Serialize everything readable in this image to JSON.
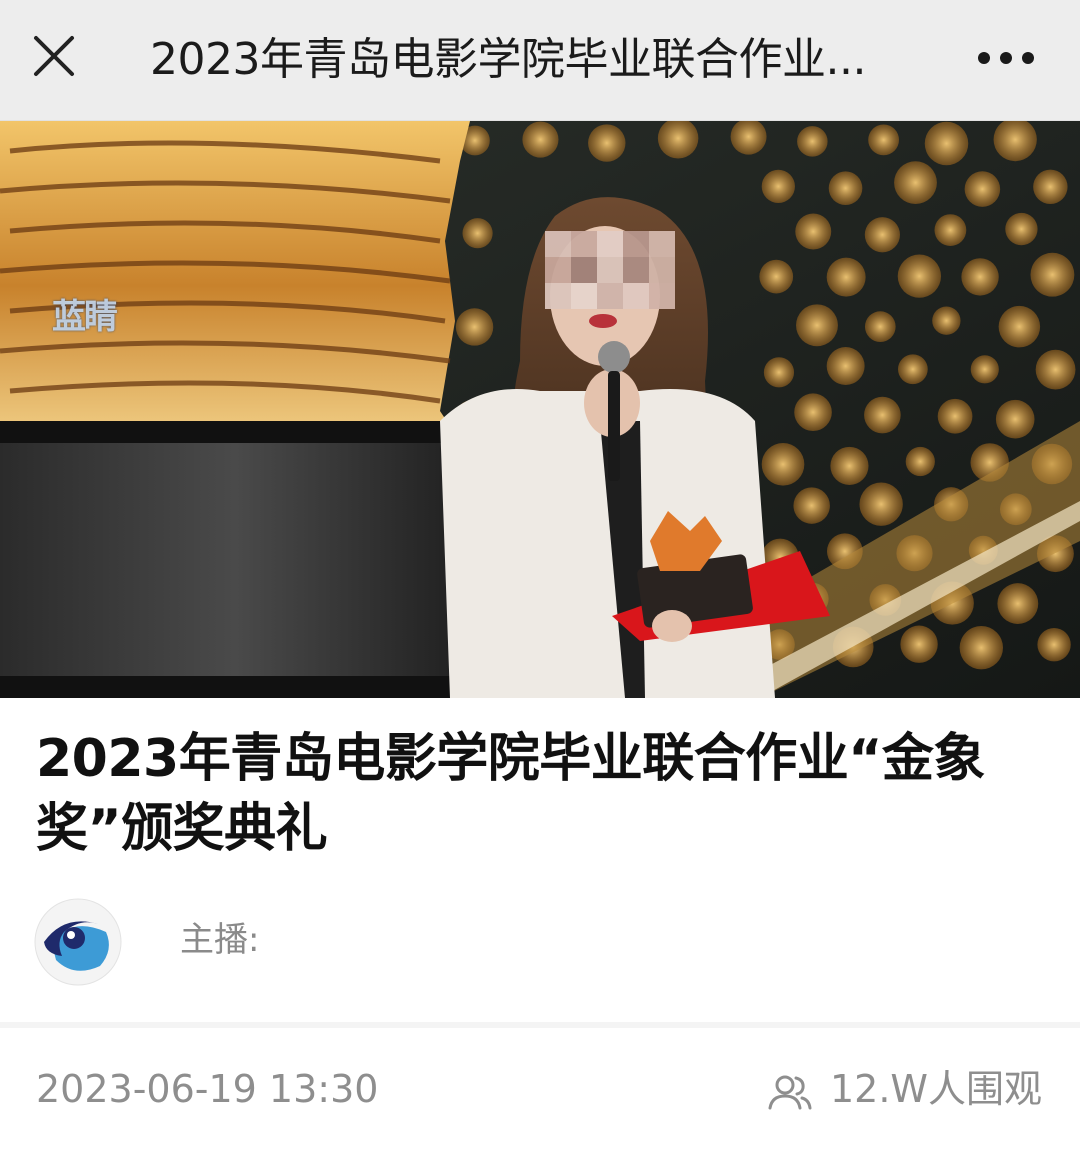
{
  "nav": {
    "title": "2023年青岛电影学院毕业联合作业...",
    "close_icon": "close-icon",
    "more_icon": "more-dots-icon"
  },
  "hero": {
    "watermark": "蓝睛"
  },
  "article": {
    "title": "2023年青岛电影学院毕业联合作业“金象奖”颁奖典礼"
  },
  "account": {
    "avatar_icon": "eye-logo-avatar",
    "host_label": "主播:"
  },
  "meta": {
    "date": "2023-06-19 13:30",
    "viewers": "12.W人围观",
    "viewer_icon": "people-icon"
  },
  "colors": {
    "topbar_bg": "#ededed",
    "text_primary": "#111111",
    "text_muted": "#8e8e8e",
    "award_red": "#d9161b",
    "gold": "#e0a23a"
  }
}
